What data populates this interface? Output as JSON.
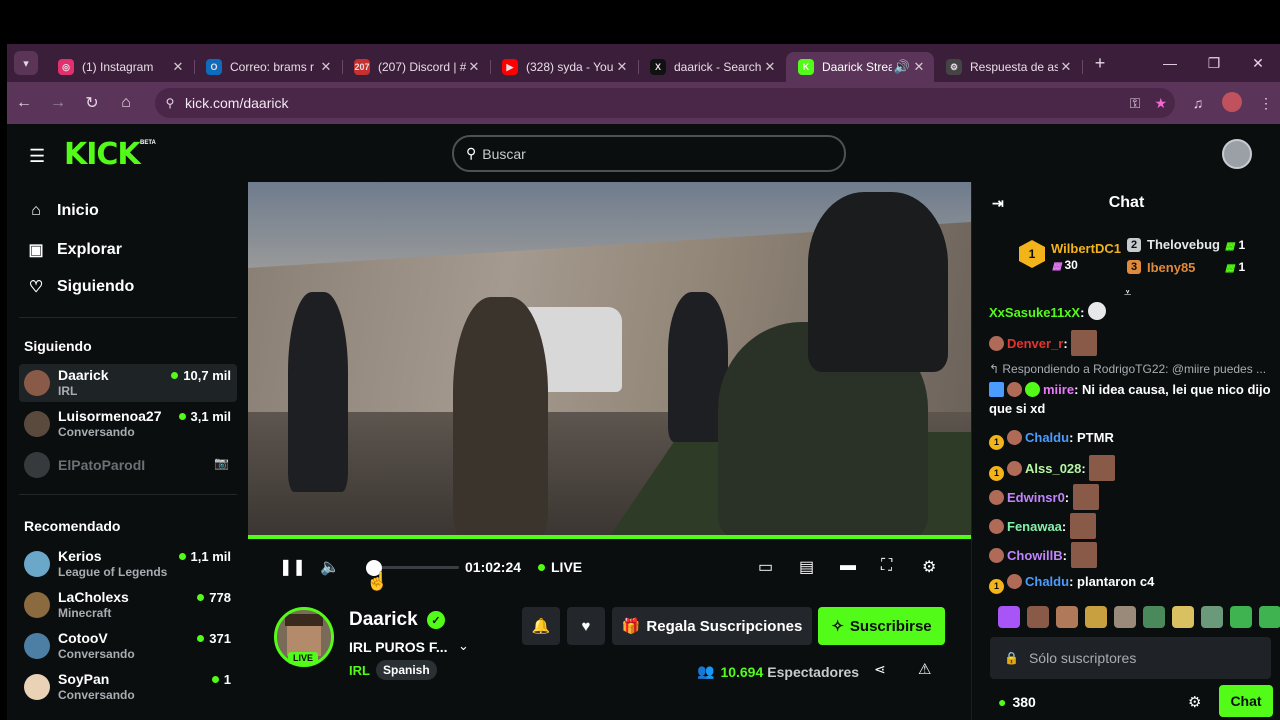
{
  "browser": {
    "tabs": [
      {
        "label": "(1) Instagram",
        "color": "#e1306c",
        "glyph": "◎"
      },
      {
        "label": "Correo: brams r",
        "color": "#0f6cbd",
        "glyph": "O"
      },
      {
        "label": "(207) Discord | #",
        "color": "#c6302e",
        "glyph": "207"
      },
      {
        "label": "(328) syda - You",
        "color": "#ff0000",
        "glyph": "▶"
      },
      {
        "label": "daarick - Search",
        "color": "#111111",
        "glyph": "X"
      },
      {
        "label": "Daarick Strea",
        "color": "#53fc18",
        "glyph": "K"
      },
      {
        "label": "Respuesta de as",
        "color": "#444444",
        "glyph": "⚙"
      }
    ],
    "url": "kick.com/daarick"
  },
  "header": {
    "search_placeholder": "Buscar",
    "logo": "KICK",
    "beta": "BETA"
  },
  "sidebar": {
    "nav": [
      "Inicio",
      "Explorar",
      "Siguiendo"
    ],
    "following_title": "Siguiendo",
    "following": [
      {
        "name": "Daarick",
        "cat": "IRL",
        "viewers": "10,7 mil",
        "color": "#8a5a48"
      },
      {
        "name": "Luisormenoa27",
        "cat": "Conversando",
        "viewers": "3,1 mil",
        "color": "#5a4a3e"
      },
      {
        "name": "ElPatoParodI",
        "cat": "",
        "viewers": "",
        "color": "#6b7075"
      }
    ],
    "recommended_title": "Recomendado",
    "recommended": [
      {
        "name": "Kerios",
        "cat": "League of Legends",
        "viewers": "1,1 mil",
        "color": "#6aa7c9"
      },
      {
        "name": "LaCholexs",
        "cat": "Minecraft",
        "viewers": "778",
        "color": "#8a6a3e"
      },
      {
        "name": "CotooV",
        "cat": "Conversando",
        "viewers": "371",
        "color": "#4d7fa5"
      },
      {
        "name": "SoyPan",
        "cat": "Conversando",
        "viewers": "1",
        "color": "#e9d2b6"
      }
    ]
  },
  "player": {
    "time": "01:02:24",
    "live": "LIVE",
    "progress": 1.0,
    "volume": 0.05
  },
  "stream": {
    "name": "Daarick",
    "title": "IRL PUROS F...",
    "category": "IRL",
    "tag": "Spanish",
    "live_badge": "LIVE",
    "gift_label": "Regala Suscripciones",
    "subscribe_label": "Suscribirse",
    "viewers_count": "10.694",
    "viewers_label": "Espectadores"
  },
  "chat": {
    "title": "Chat",
    "leaderboard": {
      "first": {
        "rank": "1",
        "name": "WilbertDC1",
        "value": "30"
      },
      "second": {
        "name": "Thelovebug",
        "value": "1"
      },
      "third": {
        "name": "Ibeny85",
        "value": "1"
      }
    },
    "messages": [
      {
        "user": "XxSasuke11xX",
        "color": "#53fc18",
        "text": ""
      },
      {
        "user": "Denver_r",
        "color": "#e3342f",
        "text": ""
      },
      {
        "reply": "Respondiendo a RodrigoTG22: @miire puedes ..."
      },
      {
        "user": "miire",
        "color": "#e879f9",
        "text": "Ni idea causa, lei que nico dijo que si xd"
      },
      {
        "user": "Chaldu",
        "color": "#4b9cff",
        "text": "PTMR"
      },
      {
        "user": "Alss_028",
        "color": "#b7f5a3",
        "text": ""
      },
      {
        "user": "Edwinsr0",
        "color": "#c084fc",
        "text": ""
      },
      {
        "user": "Fenawaa",
        "color": "#86efac",
        "text": ""
      },
      {
        "user": "ChowillB",
        "color": "#c084fc",
        "text": ""
      },
      {
        "user": "Chaldu",
        "color": "#4b9cff",
        "text": "plantaron c4"
      }
    ],
    "input_placeholder": "Sólo suscriptores",
    "points": "380",
    "send_label": "Chat"
  }
}
